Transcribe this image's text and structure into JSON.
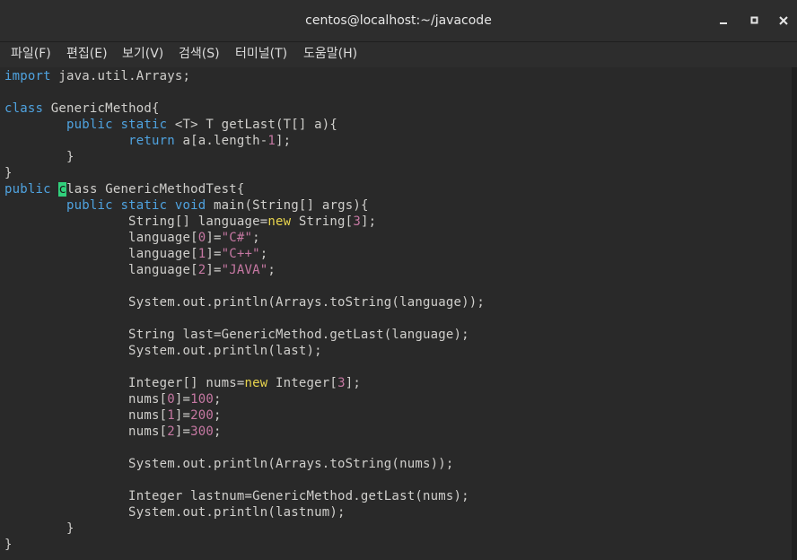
{
  "window": {
    "title": "centos@localhost:~/javacode"
  },
  "menu": [
    {
      "label": "파일(F)"
    },
    {
      "label": "편집(E)"
    },
    {
      "label": "보기(V)"
    },
    {
      "label": "검색(S)"
    },
    {
      "label": "터미널(T)"
    },
    {
      "label": "도움말(H)"
    }
  ],
  "editor": {
    "cursor_char": "c",
    "lines": [
      "import java.util.Arrays;",
      "",
      "class GenericMethod{",
      "        public static <T> T getLast(T[] a){",
      "                return a[a.length-1];",
      "        }",
      "}",
      "public class GenericMethodTest{",
      "        public static void main(String[] args){",
      "                String[] language=new String[3];",
      "                language[0]=\"C#\";",
      "                language[1]=\"C++\";",
      "                language[2]=\"JAVA\";",
      "",
      "                System.out.println(Arrays.toString(language));",
      "",
      "                String last=GenericMethod.getLast(language);",
      "                System.out.println(last);",
      "",
      "                Integer[] nums=new Integer[3];",
      "                nums[0]=100;",
      "                nums[1]=200;",
      "                nums[2]=300;",
      "",
      "                System.out.println(Arrays.toString(nums));",
      "",
      "                Integer lastnum=GenericMethod.getLast(nums);",
      "                System.out.println(lastnum);",
      "        }",
      "}"
    ]
  },
  "colors": {
    "keyword": "#4fa3e0",
    "new_keyword": "#e8d44d",
    "literal": "#c678a3",
    "text": "#d0cfcc",
    "cursor": "#31d07c"
  }
}
